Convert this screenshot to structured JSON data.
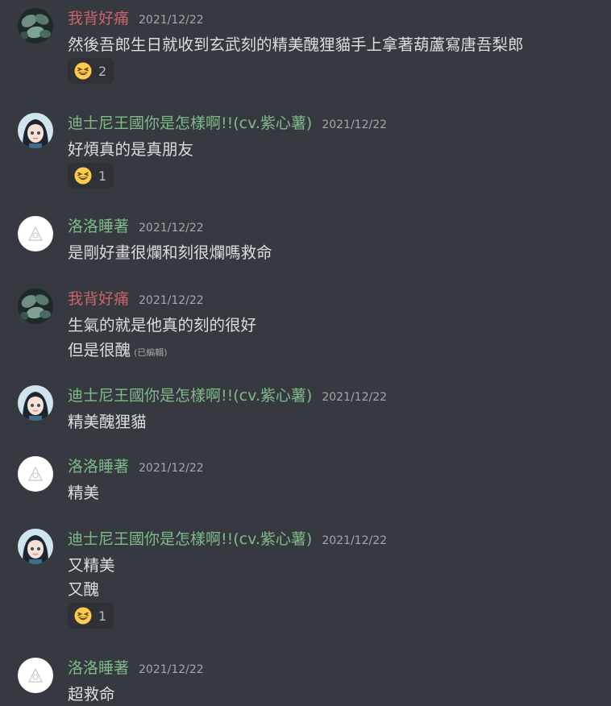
{
  "colors": {
    "background": "#36393f",
    "name_red": "#c9636a",
    "name_green": "#7fb98a",
    "timestamp": "#a3a6aa",
    "text": "#dcddde",
    "reaction_bg": "#2f3136"
  },
  "messages": [
    {
      "user": "我背好痛",
      "time": "2021/12/22",
      "avatar": "plant-avatar",
      "lines": [
        "然後吾郎生日就收到玄武刻的精美醜狸貓手上拿著葫蘆寫唐吾梨郎"
      ],
      "reaction": {
        "emoji": "grinning-squinting-face-icon",
        "count": "2"
      }
    },
    {
      "user": "迪士尼王國你是怎樣啊!!(cv.紫心薯)",
      "time": "2021/12/22",
      "avatar": "anime-girl-avatar",
      "lines": [
        "好煩真的是真朋友"
      ],
      "reaction": {
        "emoji": "grinning-squinting-face-icon",
        "count": "1"
      }
    },
    {
      "user": "洛洛睡著",
      "time": "2021/12/22",
      "avatar": "white-sketch-avatar",
      "lines": [
        "是剛好畫很爛和刻很爛嗎救命"
      ]
    },
    {
      "user": "我背好痛",
      "time": "2021/12/22",
      "avatar": "plant-avatar",
      "lines": [
        "生氣的就是他真的刻的很好",
        "但是很醜"
      ],
      "edited": "(已編輯)"
    },
    {
      "user": "迪士尼王國你是怎樣啊!!(cv.紫心薯)",
      "time": "2021/12/22",
      "avatar": "anime-girl-avatar",
      "lines": [
        "精美醜狸貓"
      ]
    },
    {
      "user": "洛洛睡著",
      "time": "2021/12/22",
      "avatar": "white-sketch-avatar",
      "lines": [
        "精美"
      ]
    },
    {
      "user": "迪士尼王國你是怎樣啊!!(cv.紫心薯)",
      "time": "2021/12/22",
      "avatar": "anime-girl-avatar",
      "lines": [
        "又精美",
        "又醜"
      ],
      "reaction": {
        "emoji": "grinning-squinting-face-icon",
        "count": "1"
      }
    },
    {
      "user": "洛洛睡著",
      "time": "2021/12/22",
      "avatar": "white-sketch-avatar",
      "lines": [
        "超救命"
      ]
    }
  ]
}
